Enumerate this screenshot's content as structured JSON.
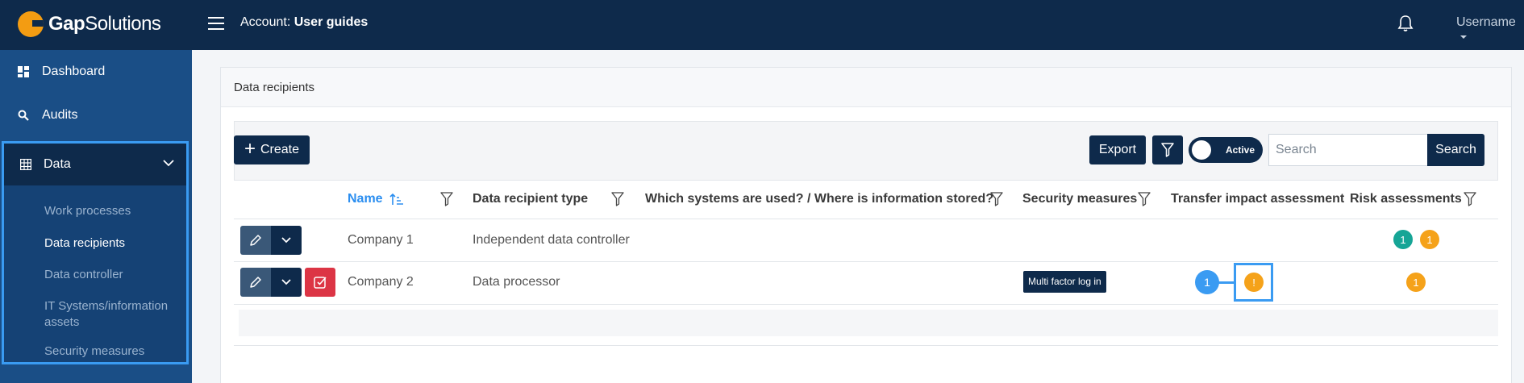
{
  "header": {
    "brand_bold": "Gap",
    "brand_light": "Solutions",
    "account_label": "Account:",
    "account_value": "User guides",
    "username": "Username"
  },
  "sidebar": {
    "items": [
      {
        "label": "Dashboard",
        "icon": "dashboard-icon"
      },
      {
        "label": "Audits",
        "icon": "search-icon"
      }
    ],
    "data_group": {
      "label": "Data",
      "icon": "table-icon",
      "sub_items": [
        {
          "label": "Work processes",
          "active": false
        },
        {
          "label": "Data recipients",
          "active": true
        },
        {
          "label": "Data controller",
          "active": false
        },
        {
          "label": "IT Systems/information assets",
          "active": false
        },
        {
          "label": "Security measures",
          "active": false
        }
      ]
    }
  },
  "main": {
    "card_title": "Data recipients",
    "toolbar": {
      "create_label": "Create",
      "export_label": "Export",
      "toggle_label": "Active",
      "search_placeholder": "Search",
      "search_button": "Search"
    },
    "columns": {
      "name": "Name",
      "type": "Data recipient type",
      "systems": "Which systems are used? / Where is information stored?",
      "security": "Security measures",
      "transfer": "Transfer impact assessment",
      "risk": "Risk assessments"
    },
    "rows": [
      {
        "name": "Company 1",
        "type": "Independent data controller",
        "security_tag": "",
        "risk_badges": [
          {
            "value": "1",
            "color": "#16a596"
          },
          {
            "value": "1",
            "color": "#f5a21a"
          }
        ]
      },
      {
        "name": "Company 2",
        "type": "Data processor",
        "security_tag": "Multi factor log in",
        "transfer_badges": [
          {
            "value": "1",
            "color": "#3a9bf2"
          },
          {
            "value": "!",
            "color": "#f5a21a"
          }
        ],
        "risk_badges": [
          {
            "value": "1",
            "color": "#f5a21a"
          }
        ]
      }
    ]
  },
  "colors": {
    "navy": "#0e2a4b",
    "sidebar": "#1a4e86",
    "accent_blue": "#3a9bf2",
    "orange": "#f5a21a",
    "teal": "#16a596",
    "danger": "#dc3545"
  }
}
